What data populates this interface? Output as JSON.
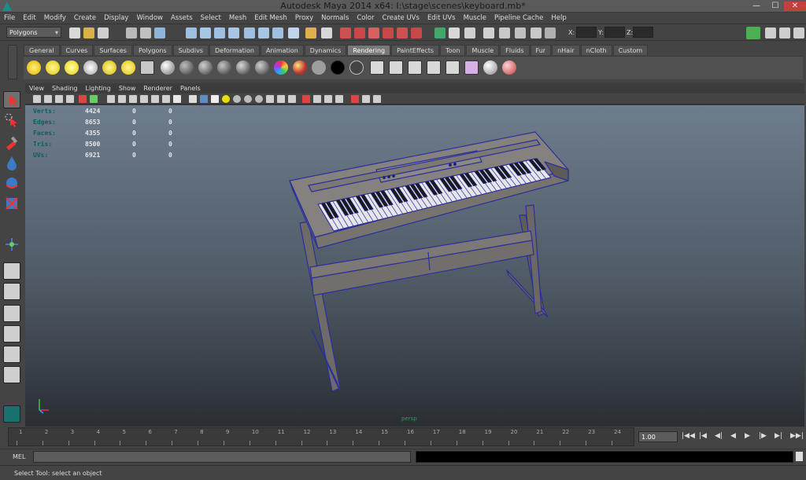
{
  "window": {
    "title": "Autodesk Maya 2014 x64: I:\\stage\\scenes\\keyboard.mb*",
    "minimize": "—",
    "maximize": "☐",
    "close": "✕"
  },
  "menubar": [
    "File",
    "Edit",
    "Modify",
    "Create",
    "Display",
    "Window",
    "Assets",
    "Select",
    "Mesh",
    "Edit Mesh",
    "Proxy",
    "Normals",
    "Color",
    "Create UVs",
    "Edit UVs",
    "Muscle",
    "Pipeline Cache",
    "Help"
  ],
  "statusline": {
    "mode": "Polygons",
    "x_label": "X:",
    "y_label": "Y:",
    "z_label": "Z:"
  },
  "shelf": {
    "tabs": [
      "General",
      "Curves",
      "Surfaces",
      "Polygons",
      "Subdivs",
      "Deformation",
      "Animation",
      "Dynamics",
      "Rendering",
      "PaintEffects",
      "Toon",
      "Muscle",
      "Fluids",
      "Fur",
      "nHair",
      "nCloth",
      "Custom"
    ],
    "active_tab": "Rendering"
  },
  "panel": {
    "menus": [
      "View",
      "Shading",
      "Lighting",
      "Show",
      "Renderer",
      "Panels"
    ]
  },
  "hud": {
    "rows": [
      {
        "label": "Verts:",
        "v1": "4424",
        "v2": "0",
        "v3": "0"
      },
      {
        "label": "Edges:",
        "v1": "8653",
        "v2": "0",
        "v3": "0"
      },
      {
        "label": "Faces:",
        "v1": "4355",
        "v2": "0",
        "v3": "0"
      },
      {
        "label": "Tris:",
        "v1": "8500",
        "v2": "0",
        "v3": "0"
      },
      {
        "label": "UVs:",
        "v1": "6921",
        "v2": "0",
        "v3": "0"
      }
    ],
    "camera": "persp"
  },
  "timeslider": {
    "ticks": [
      "1",
      "2",
      "3",
      "4",
      "5",
      "6",
      "7",
      "8",
      "9",
      "10",
      "11",
      "12",
      "13",
      "14",
      "15",
      "16",
      "17",
      "18",
      "19",
      "20",
      "21",
      "22",
      "23",
      "24"
    ],
    "current_frame": "1.00"
  },
  "cmdline": {
    "label": "MEL"
  },
  "helpline": {
    "text": "Select Tool: select an object"
  }
}
